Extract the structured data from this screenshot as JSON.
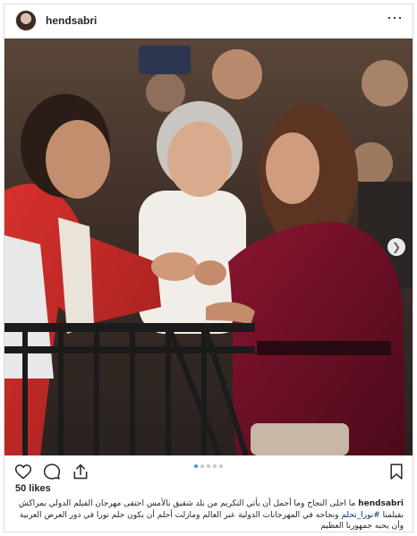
{
  "post": {
    "username": "hendsabri",
    "likes": "50 likes",
    "caption_username": "hendsabri",
    "caption_text": "ما احلى النجاح وما أجمل أن يأتي التكريم من بلد شقيق بالأمس احتفى مهرجان الفيلم الدولي بمراكش بفيلمنا",
    "hashtag": "#نورا_تحلم",
    "caption_text2": "ونجاحه في المهرجانات الدولية عبر العالم ومازلت أحلم أن يكون حلم نورا في دور العرض العربية وأن يحبه جمهورنا العظيم"
  },
  "carousel": {
    "current": 1,
    "total": 5
  },
  "icons": {
    "more": "more-options-icon",
    "next": "chevron-right-icon",
    "like": "heart-icon",
    "comment": "comment-icon",
    "share": "share-icon",
    "save": "bookmark-icon"
  },
  "colors": {
    "accent": "#3897f0",
    "border": "#dbdbdb",
    "text": "#262626"
  }
}
